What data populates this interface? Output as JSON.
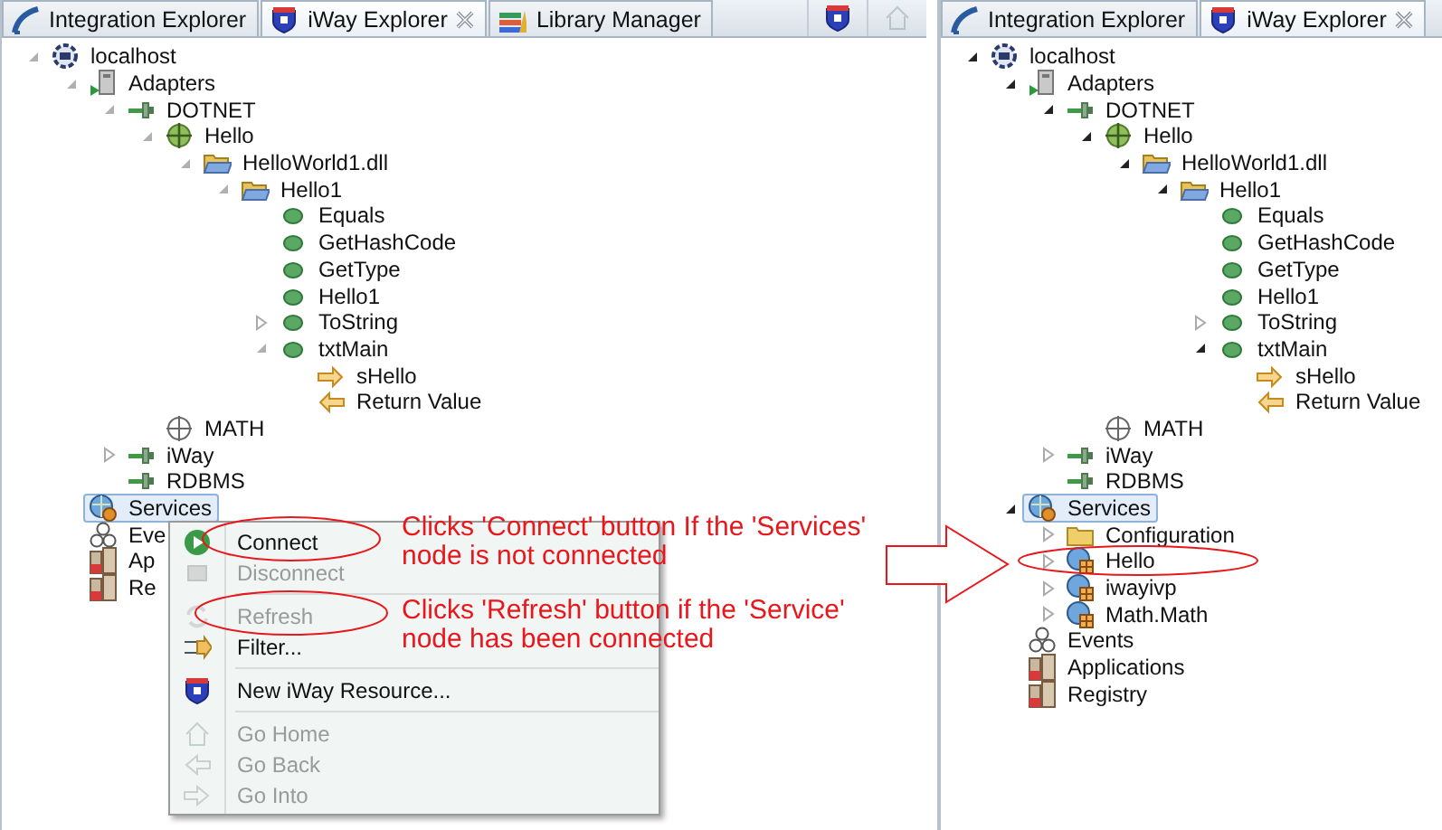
{
  "left_panel": {
    "active": false,
    "tabs": [
      {
        "label": "Integration Explorer",
        "kind": "integration",
        "selected": false,
        "closable": false
      },
      {
        "label": "iWay Explorer",
        "kind": "iway",
        "selected": true,
        "closable": true
      },
      {
        "label": "Library Manager",
        "kind": "library",
        "selected": false,
        "closable": false
      }
    ],
    "toolbar": [
      {
        "kind": "iway",
        "disabled": false
      },
      {
        "kind": "home",
        "disabled": true
      }
    ],
    "tree": [
      {
        "label": "localhost",
        "kind": "server",
        "expanded": true,
        "selected": false,
        "children": [
          {
            "label": "Adapters",
            "kind": "adapters",
            "expanded": true,
            "selected": false,
            "children": [
              {
                "label": "DOTNET",
                "kind": "plug",
                "expanded": true,
                "selected": false,
                "children": [
                  {
                    "label": "Hello",
                    "kind": "target",
                    "expanded": true,
                    "selected": false,
                    "children": [
                      {
                        "label": "HelloWorld1.dll",
                        "kind": "folder-open",
                        "expanded": true,
                        "selected": false,
                        "children": [
                          {
                            "label": "Hello1",
                            "kind": "folder-open",
                            "expanded": true,
                            "selected": false,
                            "children": [
                              {
                                "label": "Equals",
                                "kind": "method",
                                "selected": false
                              },
                              {
                                "label": "GetHashCode",
                                "kind": "method",
                                "selected": false
                              },
                              {
                                "label": "GetType",
                                "kind": "method",
                                "selected": false
                              },
                              {
                                "label": "Hello1",
                                "kind": "method",
                                "selected": false
                              },
                              {
                                "label": "ToString",
                                "kind": "method",
                                "expanded": false,
                                "selected": false
                              },
                              {
                                "label": "txtMain",
                                "kind": "method",
                                "expanded": true,
                                "selected": false,
                                "children": [
                                  {
                                    "label": "sHello",
                                    "kind": "param-in",
                                    "selected": false
                                  },
                                  {
                                    "label": "Return Value",
                                    "kind": "param-out",
                                    "selected": false
                                  }
                                ]
                              }
                            ]
                          }
                        ]
                      }
                    ]
                  },
                  {
                    "label": "MATH",
                    "kind": "target-outline",
                    "selected": false
                  }
                ]
              },
              {
                "label": "iWay",
                "kind": "plug",
                "expanded": false,
                "selected": false
              },
              {
                "label": "RDBMS",
                "kind": "plug",
                "selected": false
              }
            ]
          },
          {
            "label": "Services",
            "kind": "services",
            "selected": true
          },
          {
            "label": "Eve",
            "kind": "events",
            "selected": false
          },
          {
            "label": "Ap",
            "kind": "building",
            "selected": false
          },
          {
            "label": "Re",
            "kind": "building",
            "selected": false
          }
        ]
      }
    ]
  },
  "context_menu": {
    "items": [
      {
        "kind": "play",
        "label": "Connect",
        "disabled": false
      },
      {
        "kind": "stop",
        "label": "Disconnect",
        "disabled": true
      },
      {
        "kind": "separator"
      },
      {
        "kind": "refresh",
        "label": "Refresh",
        "disabled": true
      },
      {
        "kind": "filter",
        "label": "Filter...",
        "disabled": false
      },
      {
        "kind": "separator"
      },
      {
        "kind": "iway",
        "label": "New iWay Resource...",
        "disabled": false
      },
      {
        "kind": "separator"
      },
      {
        "kind": "home",
        "label": "Go Home",
        "disabled": true
      },
      {
        "kind": "back",
        "label": "Go Back",
        "disabled": true
      },
      {
        "kind": "forward",
        "label": "Go Into",
        "disabled": true
      }
    ]
  },
  "notes": [
    {
      "text": "Clicks 'Connect' button If the 'Services' node is not connected"
    },
    {
      "text": "Clicks 'Refresh' button if the 'Service' node has been connected"
    }
  ],
  "right_panel": {
    "active": true,
    "tabs": [
      {
        "label": "Integration Explorer",
        "kind": "integration",
        "selected": false,
        "closable": false
      },
      {
        "label": "iWay Explorer",
        "kind": "iway",
        "selected": true,
        "closable": true
      }
    ],
    "tree": [
      {
        "label": "localhost",
        "kind": "server",
        "expanded": true,
        "selected": false,
        "children": [
          {
            "label": "Adapters",
            "kind": "adapters",
            "expanded": true,
            "selected": false,
            "children": [
              {
                "label": "DOTNET",
                "kind": "plug",
                "expanded": true,
                "selected": false,
                "children": [
                  {
                    "label": "Hello",
                    "kind": "target",
                    "expanded": true,
                    "selected": false,
                    "children": [
                      {
                        "label": "HelloWorld1.dll",
                        "kind": "folder-open",
                        "expanded": true,
                        "selected": false,
                        "children": [
                          {
                            "label": "Hello1",
                            "kind": "folder-open",
                            "expanded": true,
                            "selected": false,
                            "children": [
                              {
                                "label": "Equals",
                                "kind": "method",
                                "selected": false
                              },
                              {
                                "label": "GetHashCode",
                                "kind": "method",
                                "selected": false
                              },
                              {
                                "label": "GetType",
                                "kind": "method",
                                "selected": false
                              },
                              {
                                "label": "Hello1",
                                "kind": "method",
                                "selected": false
                              },
                              {
                                "label": "ToString",
                                "kind": "method",
                                "expanded": false,
                                "selected": false
                              },
                              {
                                "label": "txtMain",
                                "kind": "method",
                                "expanded": true,
                                "selected": false,
                                "children": [
                                  {
                                    "label": "sHello",
                                    "kind": "param-in",
                                    "selected": false
                                  },
                                  {
                                    "label": "Return Value",
                                    "kind": "param-out",
                                    "selected": false
                                  }
                                ]
                              }
                            ]
                          }
                        ]
                      }
                    ]
                  },
                  {
                    "label": "MATH",
                    "kind": "target-outline",
                    "selected": false
                  }
                ]
              },
              {
                "label": "iWay",
                "kind": "plug",
                "expanded": false,
                "selected": false
              },
              {
                "label": "RDBMS",
                "kind": "plug",
                "selected": false
              }
            ]
          },
          {
            "label": "Services",
            "kind": "services",
            "expanded": true,
            "selected": true,
            "children": [
              {
                "label": "Configuration",
                "kind": "folder",
                "expanded": false,
                "selected": false
              },
              {
                "label": "Hello",
                "kind": "service",
                "expanded": false,
                "selected": false
              },
              {
                "label": "iwayivp",
                "kind": "service",
                "expanded": false,
                "selected": false
              },
              {
                "label": "Math.Math",
                "kind": "service",
                "expanded": false,
                "selected": false
              }
            ]
          },
          {
            "label": "Events",
            "kind": "events",
            "selected": false
          },
          {
            "label": "Applications",
            "kind": "building",
            "selected": false
          },
          {
            "label": "Registry",
            "kind": "building",
            "selected": false
          }
        ]
      }
    ]
  }
}
